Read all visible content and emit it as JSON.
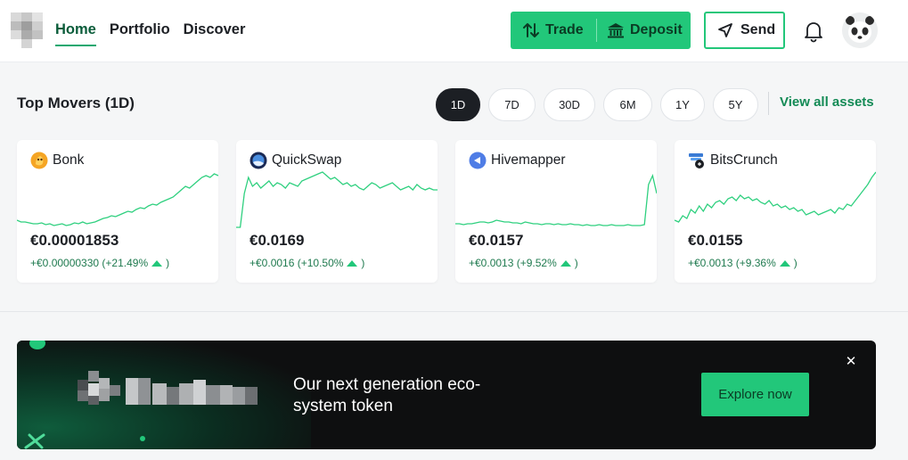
{
  "nav": {
    "items": [
      {
        "label": "Home",
        "active": true
      },
      {
        "label": "Portfolio",
        "active": false
      },
      {
        "label": "Discover",
        "active": false
      }
    ]
  },
  "actions": {
    "trade_label": "Trade",
    "deposit_label": "Deposit",
    "send_label": "Send"
  },
  "top_movers": {
    "title": "Top Movers (1D)",
    "ranges": [
      {
        "label": "1D",
        "active": true
      },
      {
        "label": "7D",
        "active": false
      },
      {
        "label": "30D",
        "active": false
      },
      {
        "label": "6M",
        "active": false
      },
      {
        "label": "1Y",
        "active": false
      },
      {
        "label": "5Y",
        "active": false
      }
    ],
    "view_all_label": "View all assets",
    "assets": [
      {
        "name": "Bonk",
        "icon": "bonk-icon",
        "price": "€0.00001853",
        "change": "+€0.00000330 (+21.49%",
        "change_suffix": ")",
        "spark": [
          60,
          62,
          62,
          63,
          64,
          64,
          63,
          65,
          64,
          66,
          65,
          64,
          66,
          65,
          63,
          64,
          62,
          64,
          63,
          62,
          60,
          58,
          57,
          55,
          56,
          54,
          52,
          50,
          51,
          48,
          46,
          47,
          44,
          42,
          43,
          40,
          38,
          36,
          34,
          30,
          26,
          22,
          24,
          20,
          16,
          12,
          10,
          12,
          8,
          10
        ]
      },
      {
        "name": "QuickSwap",
        "icon": "quickswap-icon",
        "price": "€0.0169",
        "change": "+€0.0016 (+10.50%",
        "change_suffix": ")",
        "spark": [
          68,
          68,
          30,
          12,
          22,
          18,
          24,
          20,
          16,
          22,
          18,
          20,
          24,
          18,
          20,
          22,
          16,
          14,
          12,
          10,
          8,
          6,
          10,
          14,
          12,
          16,
          20,
          18,
          22,
          20,
          24,
          26,
          22,
          18,
          20,
          24,
          22,
          20,
          18,
          22,
          26,
          24,
          22,
          26,
          20,
          24,
          26,
          24,
          26,
          26
        ]
      },
      {
        "name": "Hivemapper",
        "icon": "hivemapper-icon",
        "price": "€0.0157",
        "change": "+€0.0013 (+9.52%",
        "change_suffix": ")",
        "spark": [
          64,
          64,
          65,
          64,
          64,
          63,
          62,
          62,
          63,
          62,
          60,
          61,
          62,
          62,
          63,
          63,
          64,
          62,
          63,
          64,
          64,
          65,
          64,
          64,
          65,
          64,
          65,
          65,
          64,
          65,
          65,
          66,
          65,
          66,
          66,
          65,
          66,
          66,
          65,
          66,
          66,
          66,
          65,
          66,
          66,
          66,
          65,
          20,
          10,
          30
        ]
      },
      {
        "name": "BitsCrunch",
        "icon": "bitscrunch-icon",
        "price": "€0.0155",
        "change": "+€0.0013 (+9.36%",
        "change_suffix": ")",
        "spark": [
          60,
          62,
          55,
          58,
          48,
          52,
          44,
          50,
          42,
          46,
          40,
          38,
          42,
          36,
          34,
          38,
          32,
          36,
          34,
          38,
          36,
          40,
          42,
          38,
          44,
          42,
          46,
          44,
          48,
          46,
          50,
          48,
          54,
          52,
          50,
          54,
          52,
          50,
          48,
          52,
          46,
          48,
          42,
          44,
          38,
          32,
          26,
          20,
          12,
          6
        ]
      }
    ]
  },
  "banner": {
    "headline": "Our next generation eco-system token",
    "cta_label": "Explore now",
    "close_icon": "close-icon"
  },
  "colors": {
    "accent": "#22c77a",
    "accent_text": "#138a55",
    "spark": "#2fd07f"
  }
}
